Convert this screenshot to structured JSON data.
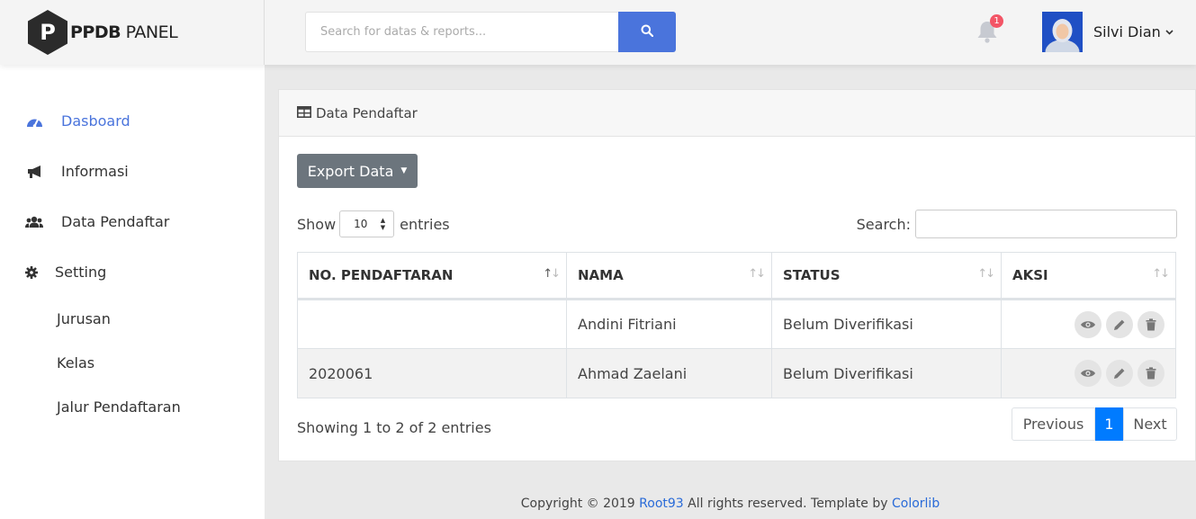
{
  "brand": {
    "mark": "P",
    "bold": "PPDB",
    "light": " PANEL"
  },
  "search": {
    "placeholder": "Search for datas & reports..."
  },
  "notifications": {
    "count": "1"
  },
  "user": {
    "name": "Silvi Dian"
  },
  "sidebar": {
    "items": [
      {
        "label": "Dasboard",
        "icon": "dashboard-icon",
        "active": true
      },
      {
        "label": "Informasi",
        "icon": "megaphone-icon"
      },
      {
        "label": "Data Pendaftar",
        "icon": "users-icon"
      },
      {
        "label": "Setting",
        "icon": "gear-icon"
      }
    ],
    "sub_items": [
      "Jurusan",
      "Kelas",
      "Jalur Pendaftaran"
    ]
  },
  "card": {
    "title": "Data Pendaftar",
    "export_label": "Export Data",
    "show_label": "Show",
    "entries_label": "entries",
    "page_length": "10",
    "search_label": "Search:",
    "columns": [
      "NO. PENDAFTARAN",
      "NAMA",
      "STATUS",
      "AKSI"
    ],
    "rows": [
      {
        "no": "",
        "nama": "Andini Fitriani",
        "status": "Belum Diverifikasi"
      },
      {
        "no": "2020061",
        "nama": "Ahmad Zaelani",
        "status": "Belum Diverifikasi"
      }
    ],
    "info": "Showing 1 to 2 of 2 entries",
    "pagination": {
      "previous": "Previous",
      "current": "1",
      "next": "Next"
    }
  },
  "footer": {
    "prefix": "Copyright © 2019 ",
    "author": "Root93",
    "middle": " All rights reserved. Template by ",
    "template": "Colorlib"
  },
  "colors": {
    "accent": "#4a74dc",
    "primary": "#007bff",
    "badge": "#f35566",
    "export": "#6c757d"
  }
}
